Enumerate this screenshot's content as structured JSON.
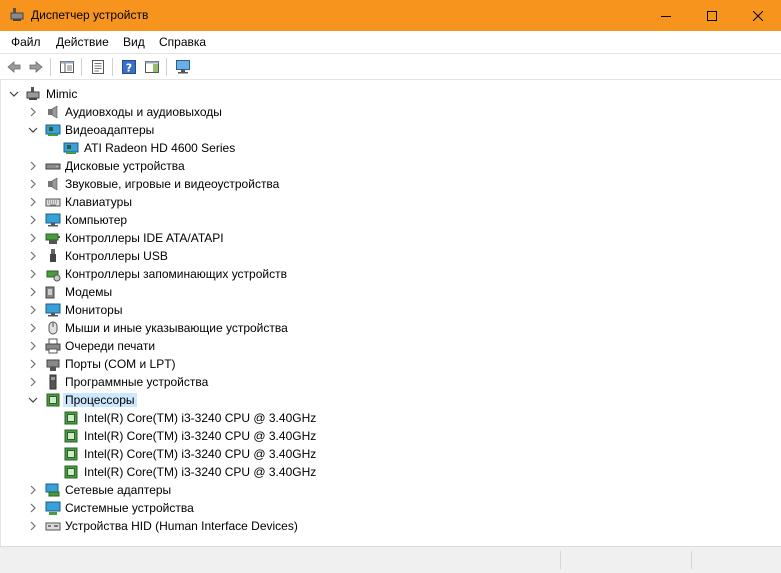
{
  "window": {
    "title": "Диспетчер устройств"
  },
  "menu": {
    "file": "Файл",
    "action": "Действие",
    "view": "Вид",
    "help": "Справка"
  },
  "tree": {
    "root": "Mimic",
    "items": [
      {
        "label": "Аудиовходы и аудиовыходы",
        "icon": "audio-io-icon",
        "expanded": false
      },
      {
        "label": "Видеоадаптеры",
        "icon": "display-adapter-icon",
        "expanded": true
      },
      {
        "label": "ATI Radeon HD 4600 Series",
        "icon": "display-adapter-icon",
        "child": true
      },
      {
        "label": "Дисковые устройства",
        "icon": "disk-drive-icon",
        "expanded": false
      },
      {
        "label": "Звуковые, игровые и видеоустройства",
        "icon": "sound-icon",
        "expanded": false
      },
      {
        "label": "Клавиатуры",
        "icon": "keyboard-icon",
        "expanded": false
      },
      {
        "label": "Компьютер",
        "icon": "computer-icon",
        "expanded": false
      },
      {
        "label": "Контроллеры IDE ATA/ATAPI",
        "icon": "ide-controller-icon",
        "expanded": false
      },
      {
        "label": "Контроллеры USB",
        "icon": "usb-icon",
        "expanded": false
      },
      {
        "label": "Контроллеры запоминающих устройств",
        "icon": "storage-controller-icon",
        "expanded": false
      },
      {
        "label": "Модемы",
        "icon": "modem-icon",
        "expanded": false
      },
      {
        "label": "Мониторы",
        "icon": "monitor-icon",
        "expanded": false
      },
      {
        "label": "Мыши и иные указывающие устройства",
        "icon": "mouse-icon",
        "expanded": false
      },
      {
        "label": "Очереди печати",
        "icon": "printer-icon",
        "expanded": false
      },
      {
        "label": "Порты (COM и LPT)",
        "icon": "port-icon",
        "expanded": false
      },
      {
        "label": "Программные устройства",
        "icon": "software-device-icon",
        "expanded": false
      },
      {
        "label": "Процессоры",
        "icon": "processor-icon",
        "expanded": true,
        "selected": true
      },
      {
        "label": "Intel(R) Core(TM) i3-3240 CPU @ 3.40GHz",
        "icon": "processor-icon",
        "child": true
      },
      {
        "label": "Intel(R) Core(TM) i3-3240 CPU @ 3.40GHz",
        "icon": "processor-icon",
        "child": true
      },
      {
        "label": "Intel(R) Core(TM) i3-3240 CPU @ 3.40GHz",
        "icon": "processor-icon",
        "child": true
      },
      {
        "label": "Intel(R) Core(TM) i3-3240 CPU @ 3.40GHz",
        "icon": "processor-icon",
        "child": true
      },
      {
        "label": "Сетевые адаптеры",
        "icon": "network-adapter-icon",
        "expanded": false
      },
      {
        "label": "Системные устройства",
        "icon": "system-device-icon",
        "expanded": false
      },
      {
        "label": "Устройства HID (Human Interface Devices)",
        "icon": "hid-icon",
        "expanded": false
      }
    ]
  },
  "colors": {
    "titlebar": "#f7941d",
    "selection": "#cce8ff"
  }
}
